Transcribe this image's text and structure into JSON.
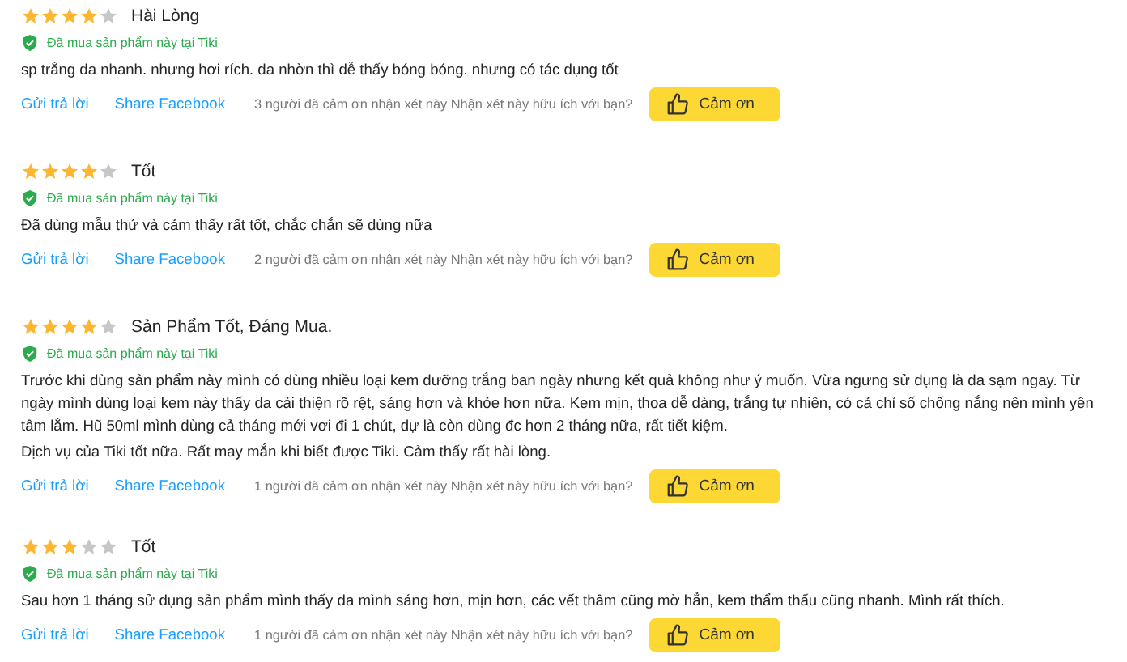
{
  "reviews": [
    {
      "stars": 4,
      "title": "Hài Lòng",
      "verified": "Đã mua sản phẩm này tại Tiki",
      "body": [
        "sp trắng da nhanh. nhưng hơi rích. da nhờn thì dễ thấy bóng bóng. nhưng có tác dụng tốt"
      ],
      "reply": "Gửi trả lời",
      "share": "Share Facebook",
      "thanks_count": "3 người đã cảm ơn nhận xét này Nhận xét này hữu ích với bạn?",
      "thanks_button": "Cảm ơn"
    },
    {
      "stars": 4,
      "title": "Tốt",
      "verified": "Đã mua sản phẩm này tại Tiki",
      "body": [
        "Đã dùng mẫu thử và cảm thấy rất tốt, chắc chắn sẽ dùng nữa"
      ],
      "reply": "Gửi trả lời",
      "share": "Share Facebook",
      "thanks_count": "2 người đã cảm ơn nhận xét này Nhận xét này hữu ích với bạn?",
      "thanks_button": "Cảm ơn"
    },
    {
      "stars": 4,
      "title": "Sản Phẩm Tốt, Đáng Mua.",
      "verified": "Đã mua sản phẩm này tại Tiki",
      "body": [
        "Trước khi dùng sản phẩm này mình có dùng nhiều loại kem dưỡng trắng ban ngày nhưng kết quả không như ý muốn. Vừa ngưng sử dụng là da sạm ngay. Từ ngày mình dùng loại kem này thấy da cải thiện rõ rệt, sáng hơn và khỏe hơn nữa. Kem mịn, thoa dễ dàng, trắng tự nhiên, có cả chỉ số chống nắng nên mình yên tâm lắm. Hũ 50ml mình dùng cả tháng mới vơi đi 1 chút, dự là còn dùng đc hơn 2 tháng nữa, rất tiết kiệm.",
        "Dịch vụ của Tiki tốt nữa. Rất may mắn khi biết được Tiki. Cảm thấy rất hài lòng."
      ],
      "reply": "Gửi trả lời",
      "share": "Share Facebook",
      "thanks_count": "1 người đã cảm ơn nhận xét này Nhận xét này hữu ích với bạn?",
      "thanks_button": "Cảm ơn"
    },
    {
      "stars": 3,
      "title": "Tốt",
      "verified": "Đã mua sản phẩm này tại Tiki",
      "body": [
        "Sau hơn 1 tháng sử dụng sản phẩm mình thấy da mình sáng hơn, mịn hơn, các vết thâm cũng mờ hẳn, kem thẩm thấu cũng nhanh. Mình rất thích."
      ],
      "reply": "Gửi trả lời",
      "share": "Share Facebook",
      "thanks_count": "1 người đã cảm ơn nhận xét này Nhận xét này hữu ích với bạn?",
      "thanks_button": "Cảm ơn"
    }
  ]
}
